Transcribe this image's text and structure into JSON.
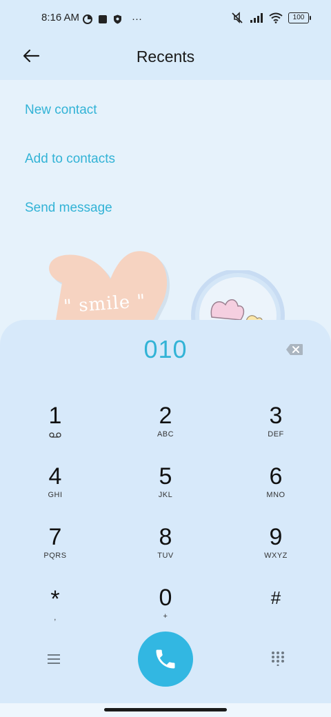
{
  "status_bar": {
    "time": "8:16 AM",
    "more": "···",
    "battery": "100",
    "icons": [
      "data-saver-icon",
      "square-icon",
      "shield-icon",
      "mute-icon",
      "signal-icon",
      "wifi-icon",
      "battery-icon"
    ]
  },
  "header": {
    "title": "Recents",
    "back_icon": "arrow-left-icon"
  },
  "actions": [
    {
      "label": "New contact"
    },
    {
      "label": "Add to contacts"
    },
    {
      "label": "Send message"
    }
  ],
  "decoration": {
    "heart_text": "\" smile \""
  },
  "dialer": {
    "number": "010",
    "keys": [
      {
        "digit": "1",
        "letters": "",
        "icon": "voicemail-icon"
      },
      {
        "digit": "2",
        "letters": "ABC"
      },
      {
        "digit": "3",
        "letters": "DEF"
      },
      {
        "digit": "4",
        "letters": "GHI"
      },
      {
        "digit": "5",
        "letters": "JKL"
      },
      {
        "digit": "6",
        "letters": "MNO"
      },
      {
        "digit": "7",
        "letters": "PQRS"
      },
      {
        "digit": "8",
        "letters": "TUV"
      },
      {
        "digit": "9",
        "letters": "WXYZ"
      },
      {
        "digit": "*",
        "letters": ","
      },
      {
        "digit": "0",
        "letters": "+"
      },
      {
        "digit": "#",
        "letters": ""
      }
    ]
  },
  "colors": {
    "accent": "#32b3d6",
    "call_button": "#32b7e2",
    "panel": "#d7e9fa",
    "background": "#e6f2fb"
  }
}
